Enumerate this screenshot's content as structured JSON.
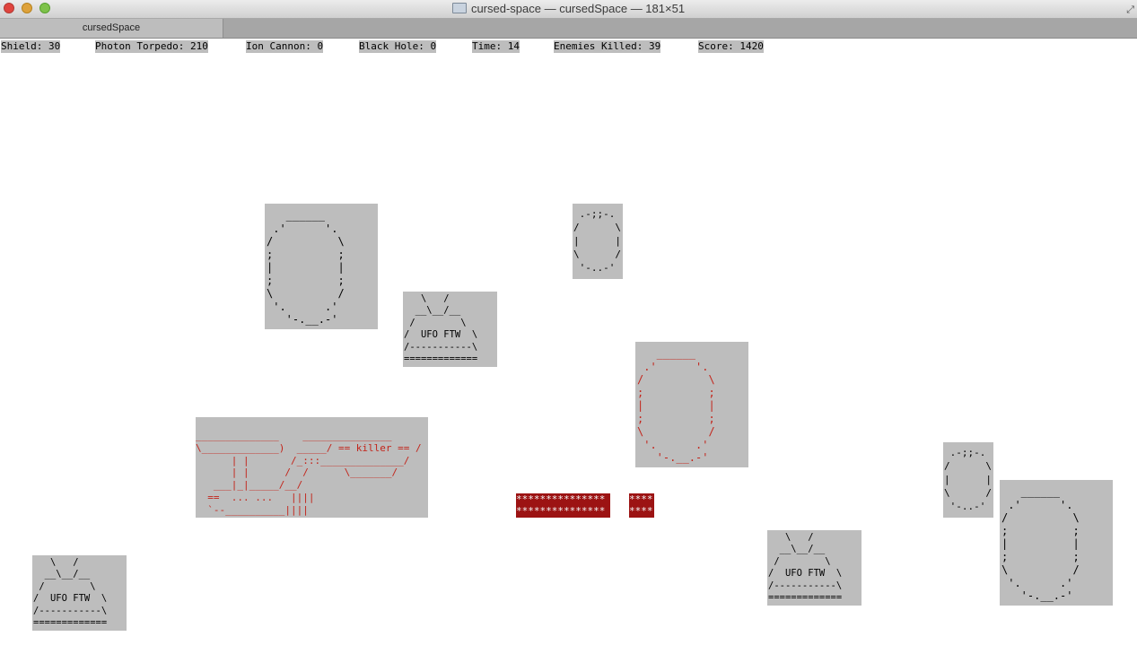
{
  "window": {
    "title": "cursed-space — cursedSpace — 181×51",
    "tab_label": "cursedSpace",
    "folder_icon": "folder-icon"
  },
  "hud": {
    "shield": "Shield: 30",
    "photon_torpedo": "Photon Torpedo: 210",
    "ion_cannon": "Ion Cannon: 0",
    "black_hole": "Black Hole: 0",
    "time": "Time: 14",
    "enemies_killed": "Enemies Killed: 39",
    "score": "Score: 1420"
  },
  "sprites": {
    "asteroid_large": "   ______\n .'      '.\n/          \\\n;          ;\n|          |\n;          ;\n\\          /\n '.      .'\n   '-.__.-'",
    "asteroid_large_red": "   ______\n .'      '.\n/          \\\n;          ;\n|          |\n;          ;\n\\          /\n '.      .'\n   '-.__.-'",
    "asteroid_small": " .-;;-.\n/      \\\n|      |\n\\      /\n '-..-'",
    "ufo": "   \\   /\n  __\\__/__\n /        \\\n/  UFO FTW  \\\n/-----------\\\n=============",
    "player_ship": "______________    _______________\n\\_____________)  _____/ == killer == /\n      | |       /_:::______________/\n      | |      /  /      \\_______/\n   ___|_|_____/__/\n  ==  ... ...   ||||\n  `--__________||||",
    "torpedo_main": "***************\n***************",
    "torpedo_small": "****\n****"
  },
  "colors": {
    "sprite_bg": "#bdbdbd",
    "enemy_red": "#c3251b",
    "torpedo_bg": "#9c1313"
  }
}
